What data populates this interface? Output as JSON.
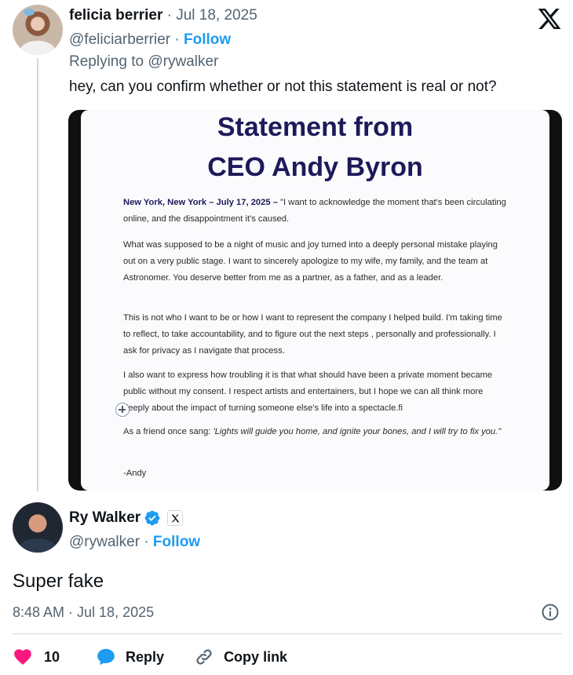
{
  "reply_tweet": {
    "author_name": "felicia berrier",
    "separator": "·",
    "date": "Jul 18, 2025",
    "handle": "@feliciarberrier",
    "follow_label": "Follow",
    "replying_to": "Replying to @rywalker",
    "text": "hey, can you confirm whether or not this statement is real or not?",
    "image": {
      "title_line1": "Statement from",
      "title_line2": "CEO Andy Byron",
      "dateline": "New York, New York – July 17, 2025 –",
      "p1": " \"I want to acknowledge the moment that's been circulating online, and the disappointment it's caused.",
      "p2": "What was supposed to be a night of music and joy turned into a deeply personal mistake playing out on a very public stage. I want to sincerely apologize to my wife, my family, and the team at Astronomer. You deserve better from me as a partner, as a father, and as a leader.",
      "p3": "This is not who I want to be or how I want to represent the company I helped build. I'm taking time to reflect, to take accountability, and to figure out the next steps , personally and professionally. I ask for privacy as I navigate that process.",
      "p4": "I also want to express how troubling it is that what should have been a private moment became public without my consent. I respect artists and entertainers, but I hope we can all think more deeply about the impact of turning someone else's life into a spectacle.fi",
      "p5_lead": "As a friend once sang: ",
      "p5_quote": "'Lights will guide you home, and ignite your bones, and I will try to fix you.\"",
      "signature": "-Andy"
    }
  },
  "main_tweet": {
    "author_name": "Ry Walker",
    "handle": "@rywalker",
    "separator": "·",
    "follow_label": "Follow",
    "text": "Super fake",
    "timestamp": "8:48 AM · Jul 18, 2025",
    "like_count": "10",
    "reply_label": "Reply",
    "copy_link_label": "Copy link"
  },
  "icons": {
    "brand": "x-logo-icon",
    "verified": "verified-badge-icon",
    "like": "heart-icon",
    "reply": "speech-bubble-icon",
    "copy": "link-icon",
    "info": "info-icon",
    "add": "plus-circle-icon"
  },
  "colors": {
    "accent": "#1d9bf0",
    "like": "#f91880",
    "secondary_text": "#536471",
    "statement_title": "#1d1a5a"
  }
}
